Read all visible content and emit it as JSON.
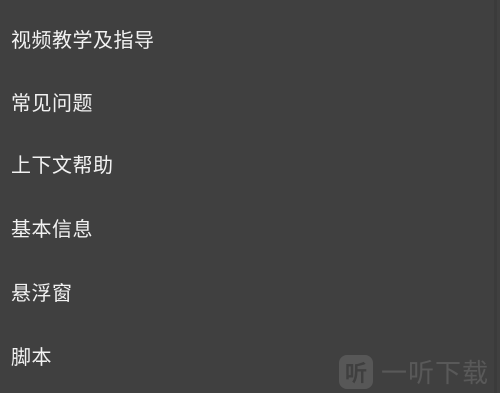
{
  "menu": {
    "items": [
      {
        "label": "视频教学及指导"
      },
      {
        "label": "常见问题"
      },
      {
        "label": "上下文帮助"
      },
      {
        "label": "基本信息"
      },
      {
        "label": "悬浮窗"
      },
      {
        "label": "脚本"
      }
    ]
  },
  "watermark": {
    "logo_char": "听",
    "text": "一听下载"
  },
  "colors": {
    "background": "#404040",
    "text": "#f2f2f2"
  }
}
